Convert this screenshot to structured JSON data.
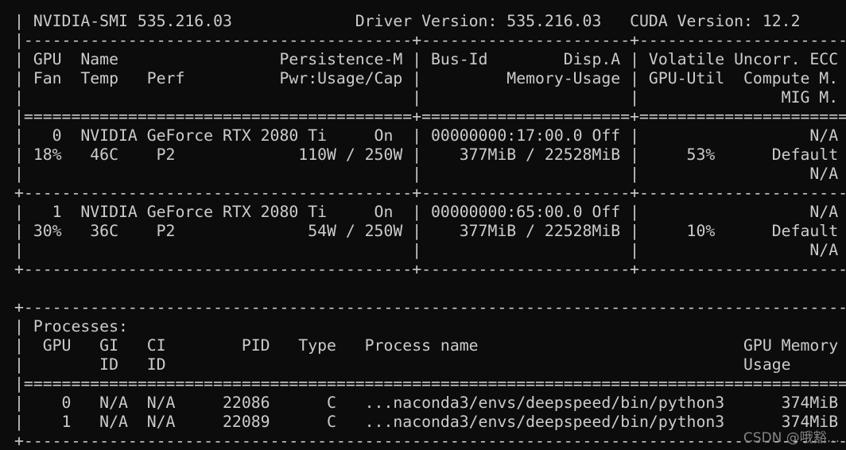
{
  "terminal": {
    "lines": [
      "| NVIDIA-SMI 535.216.03             Driver Version: 535.216.03   CUDA Version: 12.2     |",
      "|-----------------------------------------+----------------------+----------------------+",
      "| GPU  Name                 Persistence-M | Bus-Id        Disp.A | Volatile Uncorr. ECC |",
      "| Fan  Temp   Perf          Pwr:Usage/Cap |         Memory-Usage | GPU-Util  Compute M. |",
      "|                                         |                      |               MIG M. |",
      "|=========================================+======================+======================|",
      "|   0  NVIDIA GeForce RTX 2080 Ti     On  | 00000000:17:00.0 Off |                  N/A |",
      "| 18%   46C    P2             110W / 250W |    377MiB / 22528MiB |     53%      Default |",
      "|                                         |                      |                  N/A |",
      "+-----------------------------------------+----------------------+----------------------+",
      "|   1  NVIDIA GeForce RTX 2080 Ti     On  | 00000000:65:00.0 Off |                  N/A |",
      "| 30%   36C    P2              54W / 250W |    377MiB / 22528MiB |     10%      Default |",
      "|                                         |                      |                  N/A |",
      "+-----------------------------------------+----------------------+----------------------+",
      "",
      "+---------------------------------------------------------------------------------------+",
      "| Processes:                                                                            |",
      "|  GPU   GI   CI        PID   Type   Process name                            GPU Memory |",
      "|        ID   ID                                                             Usage      |",
      "|=======================================================================================|",
      "|    0   N/A  N/A     22086      C   ...naconda3/envs/deepspeed/bin/python3      374MiB |",
      "|    1   N/A  N/A     22089      C   ...naconda3/envs/deepspeed/bin/python3      374MiB |",
      "+---------------------------------------------------------------------------------------+"
    ]
  },
  "watermark": "CSDN @哦豁..."
}
